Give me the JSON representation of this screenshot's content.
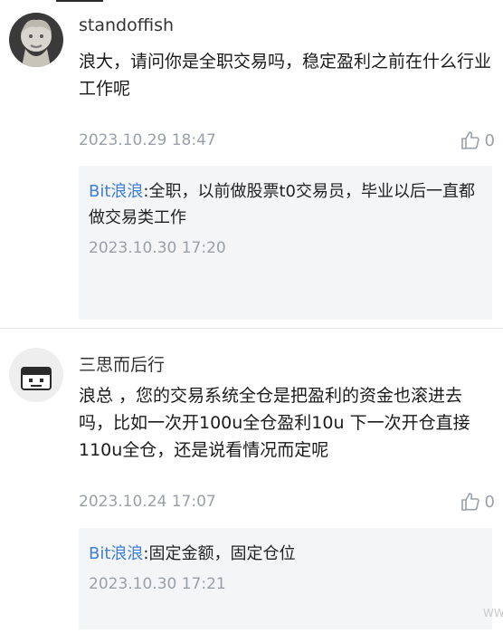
{
  "comments": [
    {
      "username": "standoffish",
      "content": "浪大，请问你是全职交易吗，稳定盈利之前在什么行业工作呢",
      "time": "2023.10.29 18:47",
      "likes": "0",
      "reply": {
        "author": "Bit浪浪",
        "text": ":全职，以前做股票t0交易员，毕业以后一直都做交易类工作",
        "time": "2023.10.30 17:20"
      }
    },
    {
      "username": "三思而后行",
      "content": "浪总 ，您的交易系统全仓是把盈利的资金也滚进去吗，比如一次开100u全仓盈利10u 下一次开仓直接110u全仓，还是说看情况而定呢",
      "time": "2023.10.24 17:07",
      "likes": "0",
      "reply": {
        "author": "Bit浪浪",
        "text": ":固定金额，固定仓位",
        "time": "2023.10.30 17:21"
      }
    }
  ],
  "watermark": "WW"
}
